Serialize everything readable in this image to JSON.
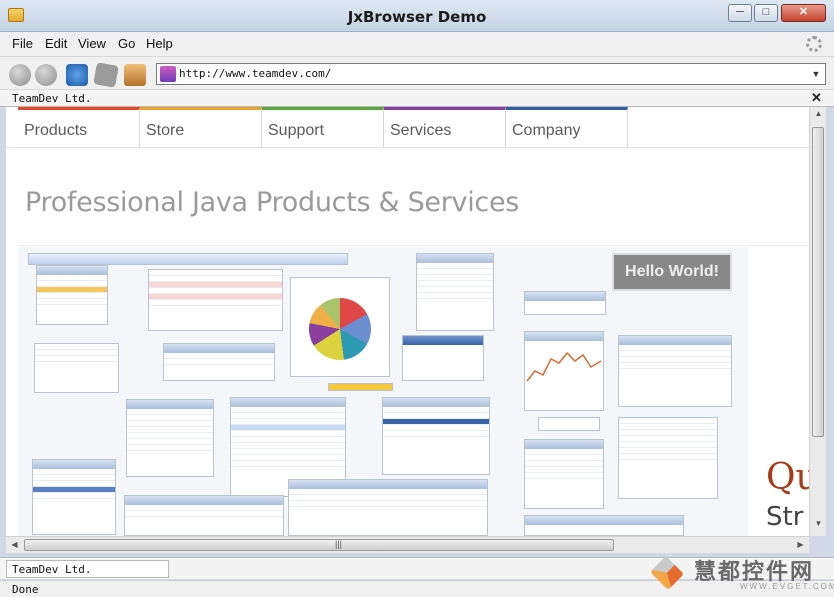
{
  "window": {
    "title": "JxBrowser Demo",
    "min": "─",
    "max": "□",
    "close": "✕"
  },
  "menu": {
    "items": [
      "File",
      "Edit",
      "View",
      "Go",
      "Help"
    ]
  },
  "toolbar": {
    "address": "http://www.teamdev.com/",
    "dropdown": "▼"
  },
  "tab": {
    "label": "TeamDev Ltd.",
    "close": "✕"
  },
  "site": {
    "nav": [
      {
        "label": "Products",
        "color": "#e04b2c"
      },
      {
        "label": "Store",
        "color": "#e8a229"
      },
      {
        "label": "Support",
        "color": "#58a83a"
      },
      {
        "label": "Services",
        "color": "#8b3ea8"
      },
      {
        "label": "Company",
        "color": "#2f5da8"
      }
    ],
    "headline": "Professional Java Products & Services",
    "hello": "Hello World!",
    "qu": "Qu",
    "str": "Str"
  },
  "scroll": {
    "up": "▲",
    "down": "▼",
    "left": "◀",
    "right": "▶",
    "grip": "|||"
  },
  "bottom_tab": {
    "label": "TeamDev Ltd."
  },
  "status": {
    "text": "Done"
  },
  "watermark": {
    "title": "慧都控件网",
    "sub": "WWW.EVGET.COM"
  }
}
